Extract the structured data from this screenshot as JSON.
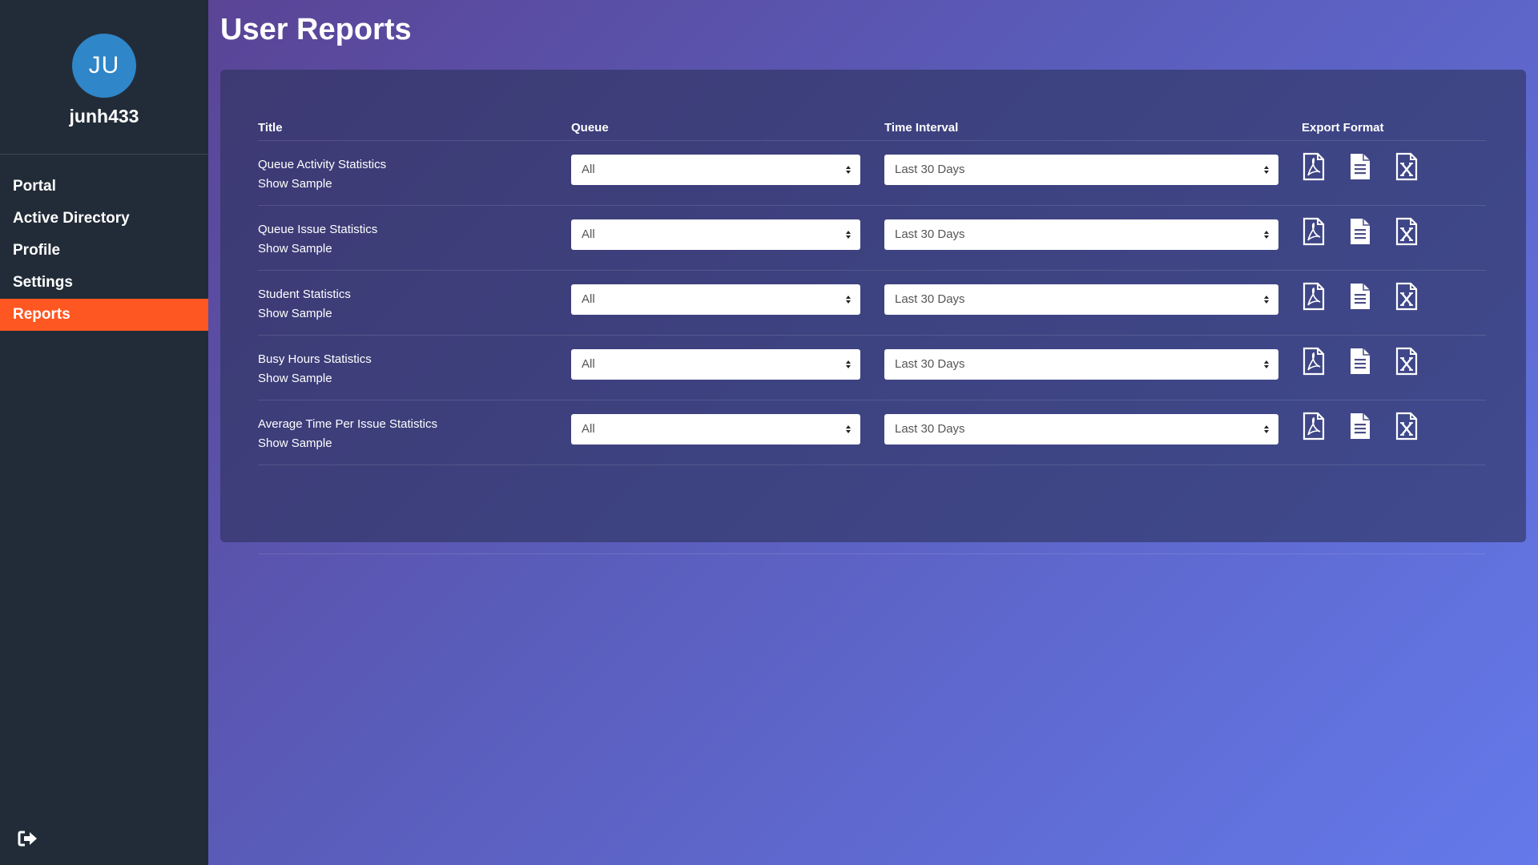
{
  "user": {
    "initials": "JU",
    "username": "junh433"
  },
  "nav": {
    "items": [
      {
        "label": "Portal"
      },
      {
        "label": "Active Directory"
      },
      {
        "label": "Profile"
      },
      {
        "label": "Settings"
      },
      {
        "label": "Reports",
        "active": true
      }
    ]
  },
  "page": {
    "title": "User Reports"
  },
  "table": {
    "headers": {
      "title": "Title",
      "queue": "Queue",
      "interval": "Time Interval",
      "export": "Export Format"
    },
    "rows": [
      {
        "title": "Queue Activity Statistics",
        "sample": "Show Sample",
        "queue": "All",
        "interval": "Last 30 Days"
      },
      {
        "title": "Queue Issue Statistics",
        "sample": "Show Sample",
        "queue": "All",
        "interval": "Last 30 Days"
      },
      {
        "title": "Student Statistics",
        "sample": "Show Sample",
        "queue": "All",
        "interval": "Last 30 Days"
      },
      {
        "title": "Busy Hours Statistics",
        "sample": "Show Sample",
        "queue": "All",
        "interval": "Last 30 Days"
      },
      {
        "title": "Average Time Per Issue Statistics",
        "sample": "Show Sample",
        "queue": "All",
        "interval": "Last 30 Days"
      }
    ],
    "export_icons": [
      "file-pdf-icon",
      "file-text-icon",
      "file-excel-icon"
    ]
  },
  "colors": {
    "sidebar": "#222c38",
    "active_nav": "#ff5722",
    "avatar": "#2f86c8"
  }
}
